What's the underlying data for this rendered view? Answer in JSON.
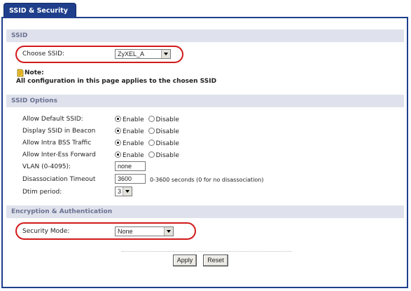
{
  "tab": {
    "label": "SSID & Security"
  },
  "ssid": {
    "header": "SSID",
    "choose_label": "Choose SSID:",
    "choose_value": "ZyXEL_A",
    "note_title": "Note:",
    "note_text": "All configuration in this page applies to the chosen SSID"
  },
  "options": {
    "header": "SSID Options",
    "rows": [
      {
        "label": "Allow Default SSID:",
        "enable": "Enable",
        "disable": "Disable"
      },
      {
        "label": "Display SSID in Beacon",
        "enable": "Enable",
        "disable": "Disable"
      },
      {
        "label": "Allow Intra BSS Traffic",
        "enable": "Enable",
        "disable": "Disable"
      },
      {
        "label": "Allow Inter-Ess Forward",
        "enable": "Enable",
        "disable": "Disable"
      }
    ],
    "vlan_label": "VLAN (0-4095):",
    "vlan_value": "none",
    "disassoc_label": "Disassociation Timeout",
    "disassoc_value": "3600",
    "disassoc_hint": "0-3600 seconds (0 for no disassociation)",
    "dtim_label": "Dtim period:",
    "dtim_value": "3"
  },
  "encryption": {
    "header": "Encryption & Authentication",
    "mode_label": "Security Mode:",
    "mode_value": "None"
  },
  "buttons": {
    "apply": "Apply",
    "reset": "Reset"
  },
  "colors": {
    "highlight": "#d21a1a",
    "tab": "#1f3f8c",
    "section": "#dfe2ec"
  }
}
